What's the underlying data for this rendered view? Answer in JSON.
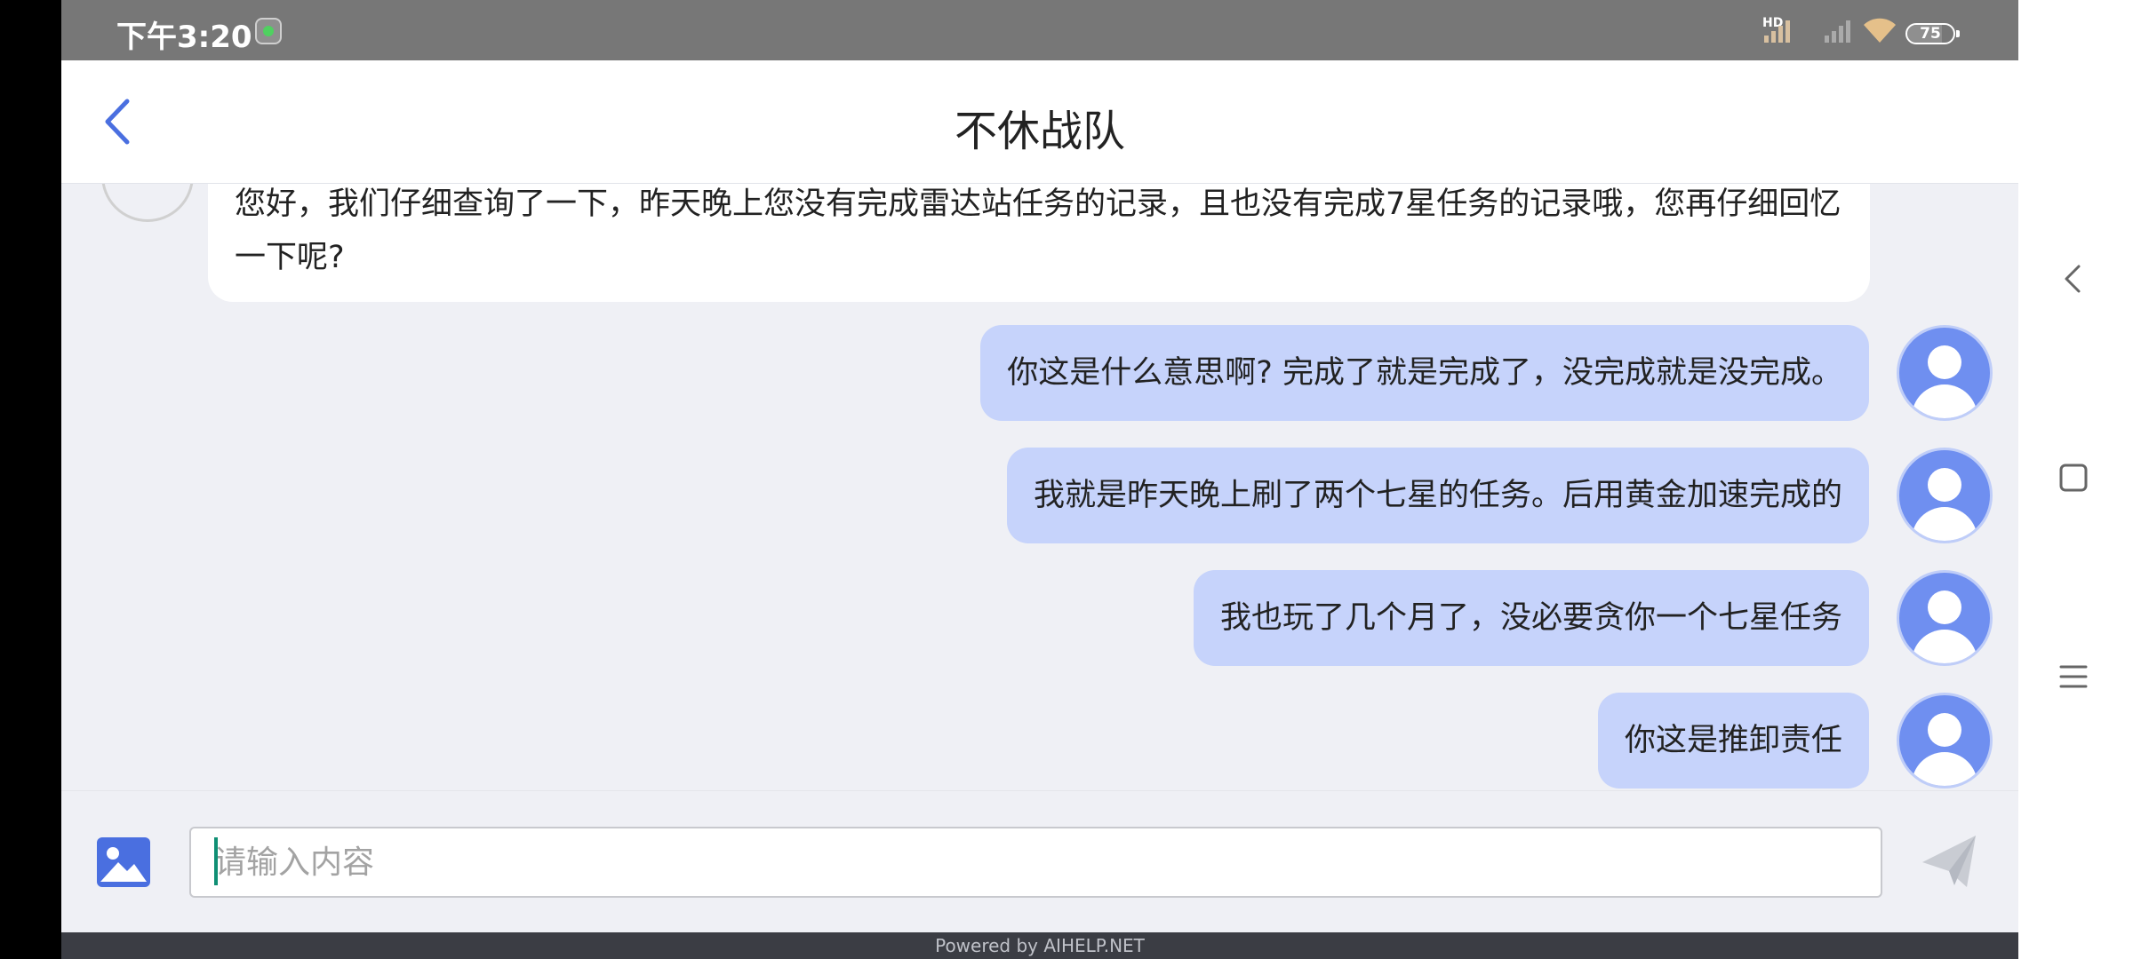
{
  "status_bar": {
    "time": "下午3:20",
    "hd_label": "HD",
    "battery": "75",
    "text_color": "#ffffff",
    "background": "#777777"
  },
  "header": {
    "title": "不休战队",
    "back_icon": "chevron-left-icon",
    "accent_color": "#4a6fe0"
  },
  "messages": [
    {
      "sender": "agent",
      "text": "您好，我们仔细查询了一下，昨天晚上您没有完成雷达站任务的记录，且也没有完成7星任务的记录哦，您再仔细回忆一下呢?"
    },
    {
      "sender": "user",
      "text": "你这是什么意思啊? 完成了就是完成了，没完成就是没完成。"
    },
    {
      "sender": "user",
      "text": "我就是昨天晚上刷了两个七星的任务。后用黄金加速完成的"
    },
    {
      "sender": "user",
      "text": "我也玩了几个月了，没必要贪你一个七星任务"
    },
    {
      "sender": "user",
      "text": "你这是推卸责任"
    }
  ],
  "input_bar": {
    "placeholder": "请输入内容",
    "image_icon": "image-icon",
    "send_icon": "send-icon"
  },
  "footer": {
    "text": "Powered by AIHELP.NET"
  },
  "system_nav": {
    "back_icon": "nav-back-icon",
    "home_icon": "nav-home-icon",
    "menu_icon": "nav-menu-icon"
  },
  "colors": {
    "user_bubble": "#c6d3fb",
    "agent_bubble": "#ffffff",
    "avatar": "#6f8ff0",
    "chat_background": "#eff0f5"
  }
}
